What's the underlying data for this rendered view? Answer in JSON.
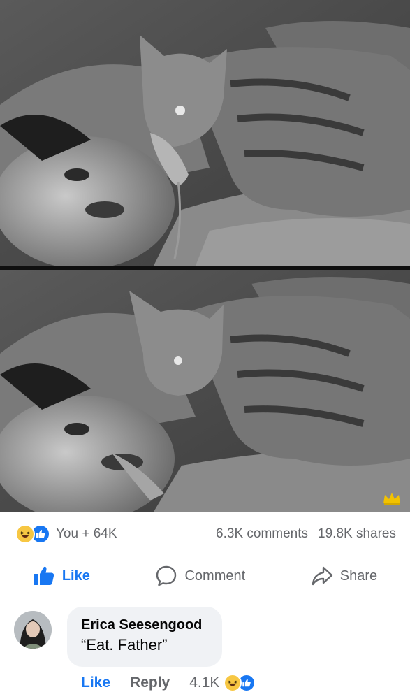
{
  "post": {
    "reactions": {
      "summary": "You + 64K",
      "icons": [
        "haha-reaction-icon",
        "like-reaction-icon"
      ]
    },
    "comments_count": "6.3K comments",
    "shares_count": "19.8K shares"
  },
  "actions": {
    "like_label": "Like",
    "comment_label": "Comment",
    "share_label": "Share"
  },
  "comment": {
    "author": "Erica Seesengood",
    "text": "“Eat. Father”",
    "like_label": "Like",
    "reply_label": "Reply",
    "reaction_count": "4.1K"
  },
  "colors": {
    "facebook_blue": "#1877f2",
    "muted_text": "#65676b",
    "bubble_bg": "#f0f2f5",
    "haha_yellow": "#f7c743"
  }
}
